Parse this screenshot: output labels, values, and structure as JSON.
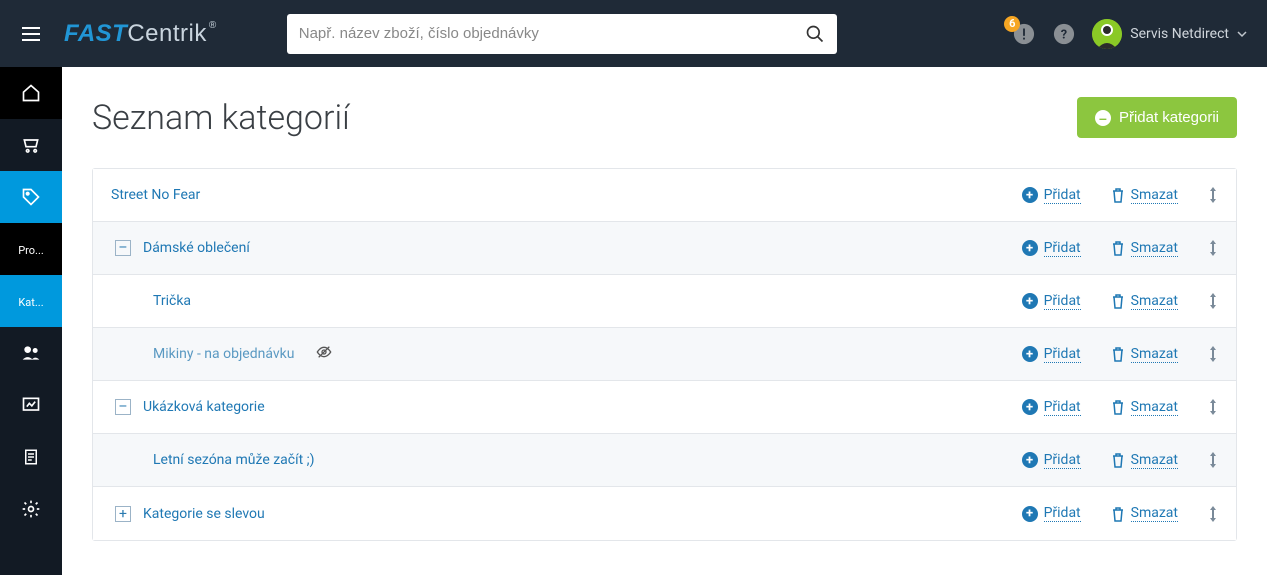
{
  "header": {
    "logo_bold": "FAST",
    "logo_thin": "Centrik",
    "search_placeholder": "Např. název zboží, číslo objednávky",
    "notif_count": "6",
    "user_name": "Servis Netdirect"
  },
  "sidebar": {
    "items": [
      {
        "label": ""
      },
      {
        "label": ""
      },
      {
        "label": ""
      },
      {
        "label": "Pro..."
      },
      {
        "label": "Kat..."
      },
      {
        "label": ""
      },
      {
        "label": ""
      },
      {
        "label": ""
      },
      {
        "label": ""
      }
    ]
  },
  "page": {
    "title": "Seznam kategorií",
    "add_button": "Přidat kategorii",
    "action_add": "Přidat",
    "action_delete": "Smazat"
  },
  "tree": [
    {
      "name": "Street No Fear",
      "level": 0,
      "expander": null
    },
    {
      "name": "Dámské oblečení",
      "level": 1,
      "expander": "-"
    },
    {
      "name": "Trička",
      "level": 2,
      "expander": null
    },
    {
      "name": "Mikiny - na objednávku",
      "level": 2,
      "expander": null,
      "hidden": true
    },
    {
      "name": "Ukázková kategorie",
      "level": 1,
      "expander": "-"
    },
    {
      "name": "Letní sezóna může začít ;)",
      "level": 2,
      "expander": null
    },
    {
      "name": "Kategorie se slevou",
      "level": 1,
      "expander": "+"
    }
  ]
}
